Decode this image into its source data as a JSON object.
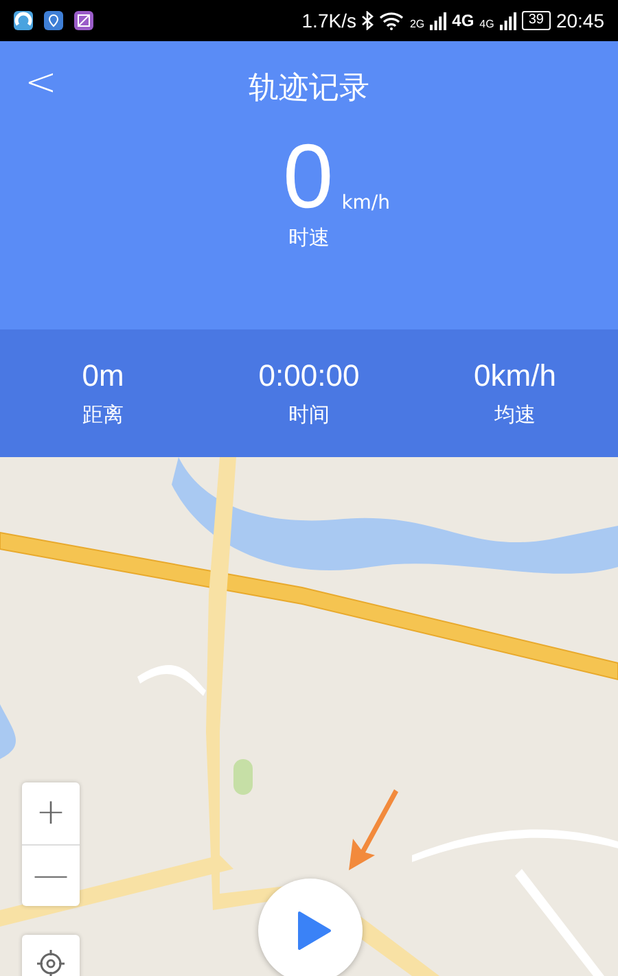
{
  "status_bar": {
    "net_speed": "1.7K/s",
    "sim1_type": "2G",
    "data_type": "4G",
    "sim2_type": "4G",
    "battery": "39",
    "time": "20:45"
  },
  "header": {
    "back": "<",
    "title": "轨迹记录"
  },
  "speed": {
    "value": "0",
    "unit": "km/h",
    "label": "时速"
  },
  "stats": [
    {
      "value": "0m",
      "label": "距离"
    },
    {
      "value": "0:00:00",
      "label": "时间"
    },
    {
      "value": "0km/h",
      "label": "均速"
    }
  ],
  "map": {
    "kind": "picture",
    "zoom_in": "+",
    "zoom_out": "—"
  }
}
